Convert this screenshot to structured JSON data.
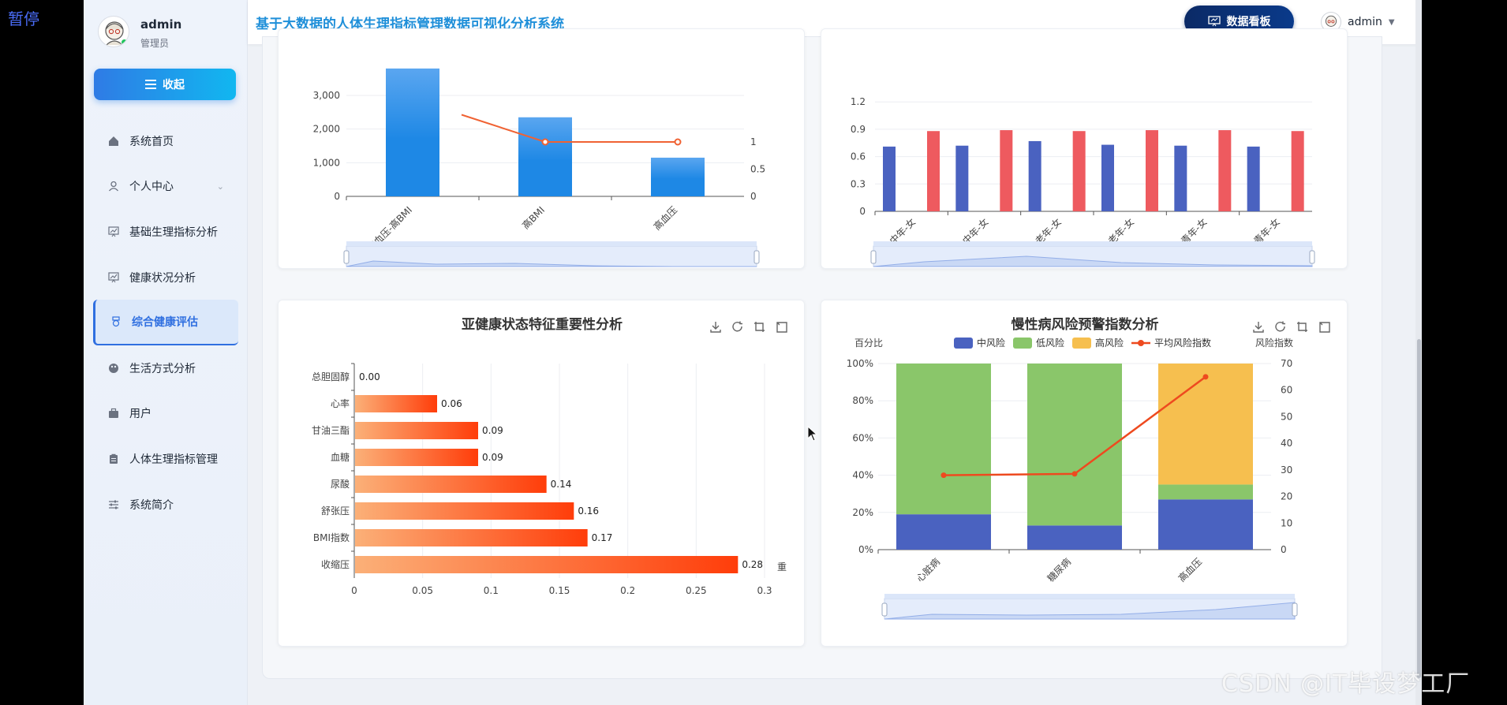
{
  "overlay": {
    "pause_label": "暂停",
    "watermark": "CSDN @IT毕设梦工厂"
  },
  "sidebar": {
    "user_name": "admin",
    "user_role": "管理员",
    "collapse_label": "收起",
    "items": [
      {
        "label": "系统首页",
        "icon": "home-icon"
      },
      {
        "label": "个人中心",
        "icon": "user-icon",
        "expandable": true
      },
      {
        "label": "基础生理指标分析",
        "icon": "chart-board-icon"
      },
      {
        "label": "健康状况分析",
        "icon": "chart-board-icon"
      },
      {
        "label": "综合健康评估",
        "icon": "badge-icon",
        "active": true
      },
      {
        "label": "生活方式分析",
        "icon": "palette-icon"
      },
      {
        "label": "用户",
        "icon": "briefcase-icon"
      },
      {
        "label": "人体生理指标管理",
        "icon": "clipboard-icon"
      },
      {
        "label": "系统简介",
        "icon": "sliders-icon"
      }
    ]
  },
  "header": {
    "title": "基于大数据的人体生理指标管理数据可视化分析系统",
    "dashboard_button": "数据看板",
    "user": "admin"
  },
  "colors": {
    "accent": "#2f6fe0",
    "title_blue": "#1f8fd9",
    "bar_blue": "#1e88e5",
    "line_orange": "#f06233"
  },
  "chart_data": [
    {
      "type": "bar",
      "categories": [
        "高血压-高BMI",
        "高BMI",
        "高血压"
      ],
      "series": [
        {
          "values": [
            3800,
            2350,
            1150
          ]
        },
        {
          "type": "line",
          "values": [
            1.5,
            1,
            1
          ]
        }
      ],
      "yticks_left": [
        "0",
        "1,000",
        "2,000",
        "3,000"
      ],
      "yticks_right": [
        "0",
        "0.5",
        "1"
      ],
      "partial": true
    },
    {
      "type": "bar",
      "categories": [
        "中年-女",
        "中年-女",
        "老年-女",
        "老年-女",
        "青年-女",
        "青年-女"
      ],
      "series": [
        {
          "values": [
            0.71,
            0.72,
            0.77,
            0.73,
            0.72,
            0.71
          ]
        },
        {
          "values": [
            0.88,
            0.89,
            0.88,
            0.89,
            0.89,
            0.88
          ]
        }
      ],
      "yticks": [
        "0",
        "0.3",
        "0.6",
        "0.9",
        "1.2"
      ],
      "partial": true
    },
    {
      "type": "bar",
      "orientation": "horizontal",
      "title": "亚健康状态特征重要性分析",
      "categories": [
        "总胆固醇",
        "心率",
        "甘油三酯",
        "血糖",
        "尿酸",
        "舒张压",
        "BMI指数",
        "收缩压"
      ],
      "values": [
        0.0,
        0.06,
        0.09,
        0.09,
        0.14,
        0.16,
        0.17,
        0.28
      ],
      "value_labels": [
        "0.00",
        "0.06",
        "0.09",
        "0.09",
        "0.14",
        "0.16",
        "0.17",
        "0.28"
      ],
      "xticks": [
        "0",
        "0.05",
        "0.1",
        "0.15",
        "0.2",
        "0.25",
        "0.3"
      ],
      "xlim": [
        0,
        0.3
      ],
      "xlabel": "重"
    },
    {
      "type": "bar",
      "stacked": true,
      "title": "慢性病风险预警指数分析",
      "categories": [
        "心脏病",
        "糖尿病",
        "高血压"
      ],
      "series": [
        {
          "name": "中风险",
          "values": [
            19,
            13,
            27
          ],
          "color": "#4a62c0"
        },
        {
          "name": "低风险",
          "values": [
            81,
            87,
            8
          ],
          "color": "#8ac66a"
        },
        {
          "name": "高风险",
          "values": [
            0,
            0,
            65
          ],
          "color": "#f6bf4f"
        },
        {
          "name": "平均风险指数",
          "type": "line",
          "values": [
            28,
            28.5,
            65
          ],
          "color": "#ee4a1f"
        }
      ],
      "ylabel_left": "百分比",
      "ylabel_right": "风险指数",
      "yticks_left": [
        "0%",
        "20%",
        "40%",
        "60%",
        "80%",
        "100%"
      ],
      "yticks_right": [
        "0",
        "10",
        "20",
        "30",
        "40",
        "50",
        "60",
        "70"
      ],
      "ylim_left": [
        0,
        100
      ],
      "ylim_right": [
        0,
        70
      ],
      "legend": "top-center"
    }
  ],
  "toolbox": [
    "download-icon",
    "refresh-icon",
    "crop-icon",
    "restore-icon"
  ]
}
